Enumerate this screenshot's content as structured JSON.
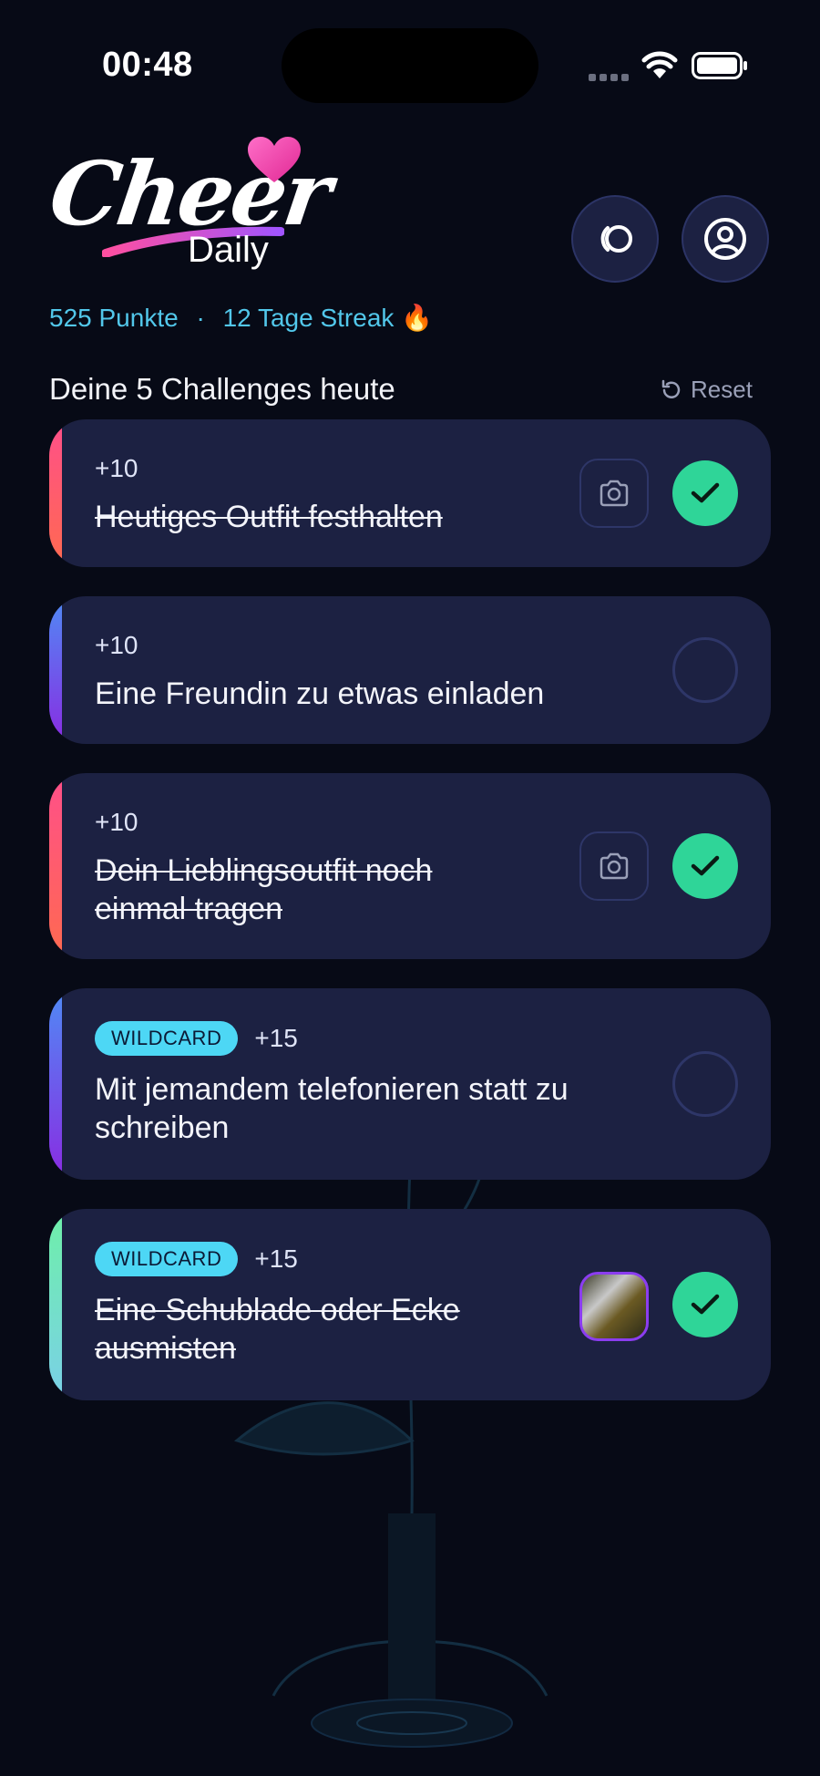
{
  "status_bar": {
    "time": "00:48"
  },
  "logo": {
    "word1": "Cheer",
    "word2": "Daily"
  },
  "header": {
    "points": "525 Punkte",
    "separator": "·",
    "streak": "12 Tage Streak",
    "streak_emoji": "🔥"
  },
  "section": {
    "title": "Deine 5 Challenges heute",
    "reset_label": "Reset"
  },
  "challenges": [
    {
      "points": "+10",
      "title": "Heutiges Outfit festhalten",
      "completed": true,
      "wildcard": false,
      "attachment": "camera-icon",
      "accent": "#ff5a6e"
    },
    {
      "points": "+10",
      "title": "Eine Freundin zu etwas einladen",
      "completed": false,
      "wildcard": false,
      "attachment": null,
      "accent": "#6a4cf0"
    },
    {
      "points": "+10",
      "title": "Dein Lieblingsoutfit noch einmal tragen",
      "completed": true,
      "wildcard": false,
      "attachment": "camera-icon",
      "accent": "#ff5a6e"
    },
    {
      "badge": "WILDCARD",
      "points": "+15",
      "title": "Mit jemandem telefonieren statt zu schreiben",
      "completed": false,
      "wildcard": true,
      "attachment": null,
      "accent": "#7b3df0"
    },
    {
      "badge": "WILDCARD",
      "points": "+15",
      "title": "Eine Schublade oder Ecke ausmisten",
      "completed": true,
      "wildcard": true,
      "attachment": "photo-thumbnail",
      "accent": "#6ee7c8"
    }
  ],
  "colors": {
    "background": "#070a16",
    "card": "#1c2142",
    "accent_cyan": "#52c7ea",
    "check_green": "#2fd598",
    "badge": "#4dd7f5"
  }
}
